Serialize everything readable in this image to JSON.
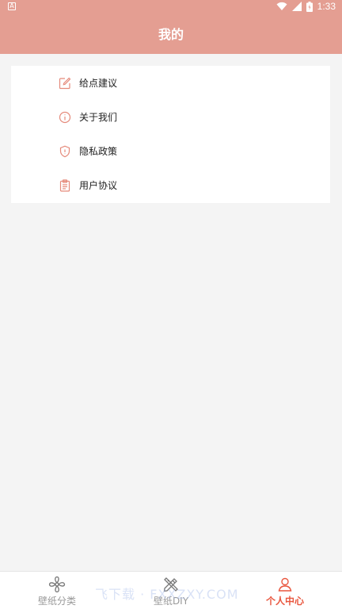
{
  "status_bar": {
    "notification_icon": "A",
    "time": "1:33",
    "icons": [
      "wifi-icon",
      "signal-icon",
      "battery-icon"
    ]
  },
  "header": {
    "title": "我的"
  },
  "menu": {
    "items": [
      {
        "label": "给点建议",
        "icon": "edit-icon"
      },
      {
        "label": "关于我们",
        "icon": "info-icon"
      },
      {
        "label": "隐私政策",
        "icon": "shield-icon"
      },
      {
        "label": "用户协议",
        "icon": "clipboard-icon"
      }
    ]
  },
  "bottom_nav": {
    "items": [
      {
        "label": "壁纸分类",
        "icon": "pinwheel-icon",
        "active": false
      },
      {
        "label": "壁纸DIY",
        "icon": "pencil-ruler-icon",
        "active": false
      },
      {
        "label": "个人中心",
        "icon": "user-icon",
        "active": true
      }
    ]
  },
  "watermark": "飞下载 · FXXZXY.COM",
  "colors": {
    "header_bg": "#e49e92",
    "accent": "#e9573f",
    "icon": "#e58a7b",
    "page_bg": "#f4f4f4"
  }
}
